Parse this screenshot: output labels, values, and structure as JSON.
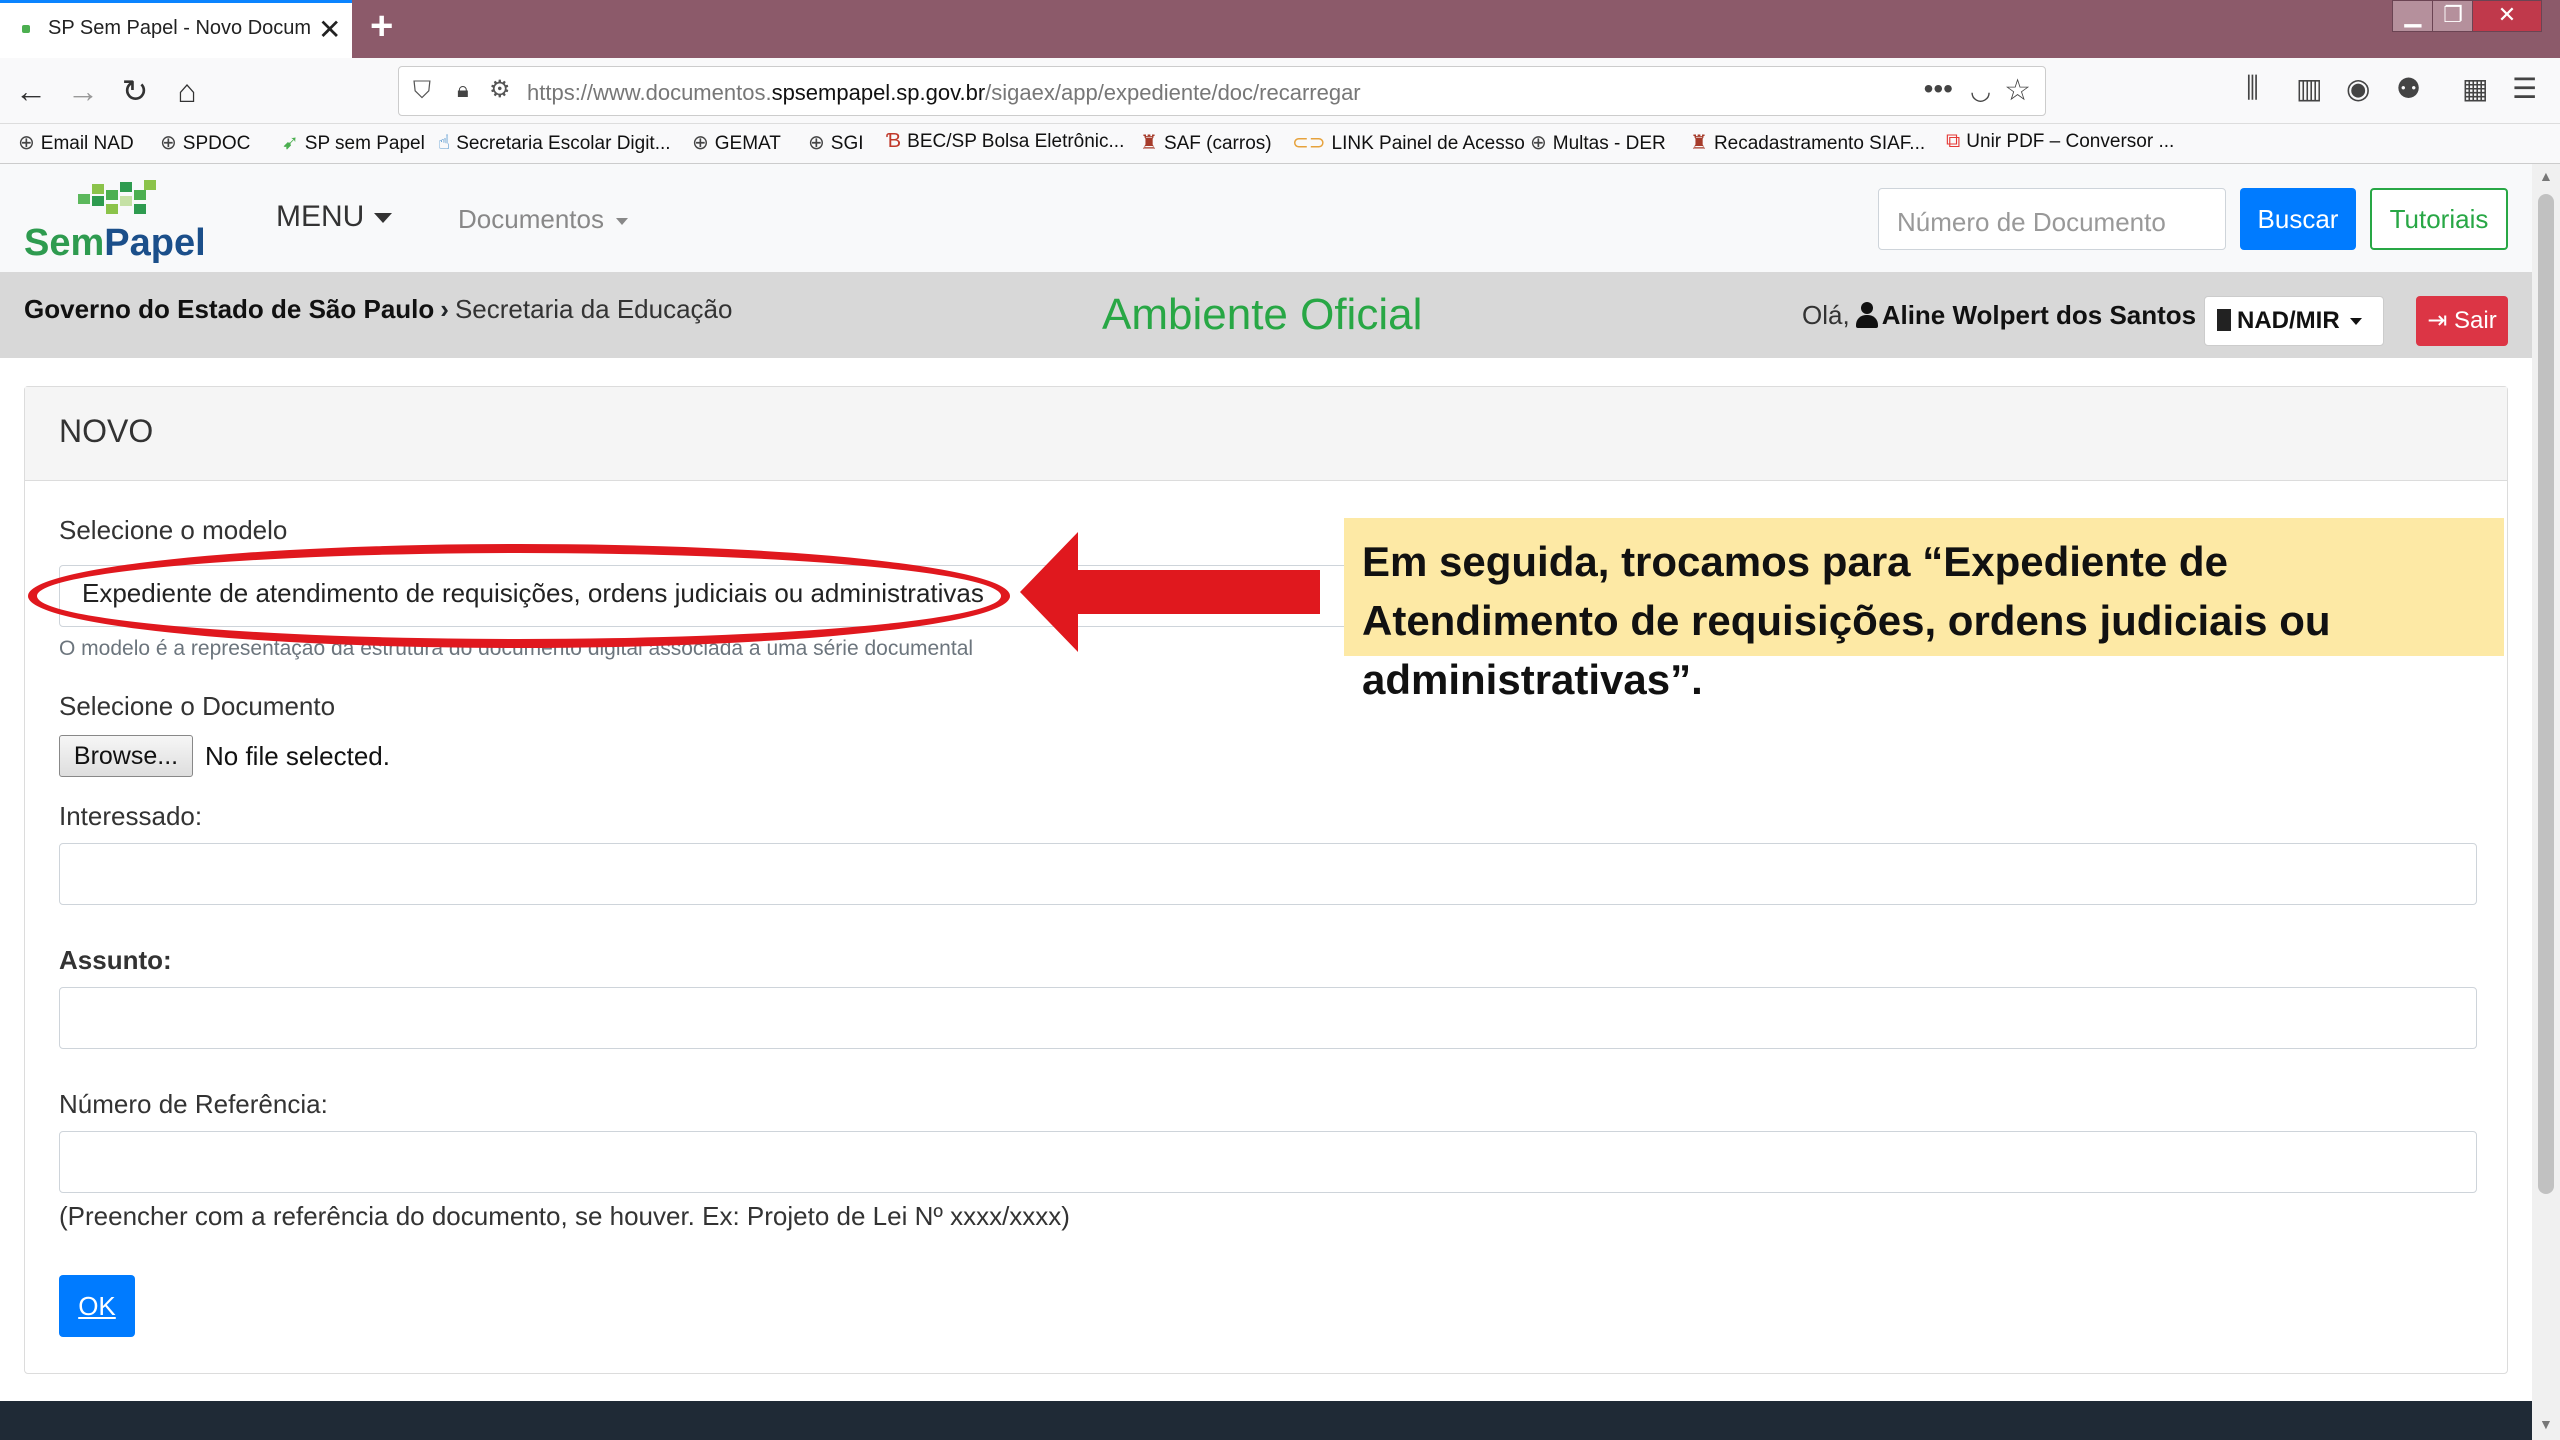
{
  "browser": {
    "tab_title": "SP Sem Papel - Novo Documento",
    "new_tab": "+",
    "url_prefix": "https://www.documentos.",
    "url_domain": "spsempapel.sp.gov.br",
    "url_path": "/sigaex/app/expediente/doc/recarregar",
    "bookmarks": [
      {
        "label": "Email NAD",
        "icon": "globe-icon"
      },
      {
        "label": "SPDOC",
        "icon": "globe-icon"
      },
      {
        "label": "SP sem Papel",
        "icon": "leaf-icon"
      },
      {
        "label": "Secretaria Escolar Digit...",
        "icon": "hand-icon"
      },
      {
        "label": "GEMAT",
        "icon": "globe-icon"
      },
      {
        "label": "SGI",
        "icon": "globe-icon"
      },
      {
        "label": "BEC/SP Bolsa Eletrônic...",
        "icon": "bec-icon"
      },
      {
        "label": "SAF (carros)",
        "icon": "seal-icon"
      },
      {
        "label": "LINK Painel de Acesso",
        "icon": "link-icon"
      },
      {
        "label": "Multas - DER",
        "icon": "globe-icon"
      },
      {
        "label": "Recadastramento SIAF...",
        "icon": "seal-icon"
      },
      {
        "label": "Unir PDF – Conversor ...",
        "icon": "pdf-icon"
      }
    ]
  },
  "header": {
    "logo_sem": "Sem",
    "logo_papel": "Papel",
    "menu_label": "MENU",
    "documents_label": "Documentos",
    "search_placeholder": "Número de Documento",
    "search_button": "Buscar",
    "tutorials_button": "Tutoriais"
  },
  "context": {
    "government": "Governo do Estado de São Paulo",
    "separator": "›",
    "secretariat": "Secretaria da Educação",
    "environment": "Ambiente Oficial",
    "greeting": "Olá,",
    "user_name": "Aline Wolpert dos Santos",
    "unit": "NAD/MIR",
    "logout": "Sair"
  },
  "form": {
    "card_title": "NOVO",
    "model_label": "Selecione o modelo",
    "model_value": "Expediente de atendimento de requisições, ordens judiciais ou administrativas",
    "model_help": "O modelo é a representação da estrutura do documento digital associada a uma série documental",
    "document_label": "Selecione o Documento",
    "browse_button": "Browse...",
    "file_status": "No file selected.",
    "interessado_label": "Interessado:",
    "assunto_label": "Assunto:",
    "referencia_label": "Número de Referência:",
    "referencia_help": "(Preencher com a referência do documento, se houver. Ex: Projeto de Lei Nº xxxx/xxxx)",
    "ok_button": "OK"
  },
  "annotation": {
    "callout_text": "Em seguida, trocamos para “Expediente de Atendimento de requisições, ordens judiciais ou administrativas”.",
    "highlight_color": "#e0181e",
    "callout_bg": "#fde9a5"
  },
  "colors": {
    "primary": "#007bff",
    "success": "#28a745",
    "danger": "#dc3545",
    "tabbar": "#8c5a6a"
  }
}
